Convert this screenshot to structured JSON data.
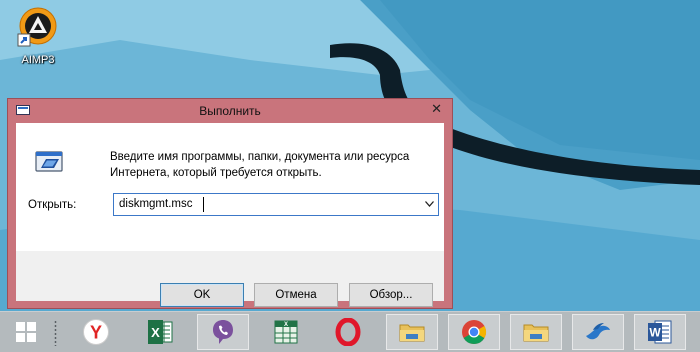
{
  "desktop": {
    "icons": [
      {
        "label": "AIMP3"
      }
    ]
  },
  "run_dialog": {
    "title": "Выполнить",
    "close_glyph": "✕",
    "description": "Введите имя программы, папки, документа или ресурса Интернета, который требуется открыть.",
    "open_label": "Открыть:",
    "open_value": "diskmgmt.msc",
    "ok_label": "OK",
    "cancel_label": "Отмена",
    "browse_label": "Обзор..."
  },
  "taskbar": {
    "items": [
      {
        "name": "start-icon",
        "state": "normal"
      },
      {
        "name": "yandex-browser-icon",
        "state": "normal"
      },
      {
        "name": "excel-icon",
        "state": "normal"
      },
      {
        "name": "viber-icon",
        "state": "running"
      },
      {
        "name": "excel-workbook-icon",
        "state": "normal"
      },
      {
        "name": "opera-icon",
        "state": "normal"
      },
      {
        "name": "file-explorer-icon",
        "state": "running"
      },
      {
        "name": "chrome-icon",
        "state": "running"
      },
      {
        "name": "file-explorer-icon",
        "state": "running"
      },
      {
        "name": "bird-app-icon",
        "state": "running"
      },
      {
        "name": "word-icon",
        "state": "running"
      }
    ]
  },
  "colors": {
    "dialog_frame": "#c9747c",
    "desktop": "#6fb8d8",
    "taskbar": "#b4babd",
    "accent_blue": "#3c78c8"
  }
}
